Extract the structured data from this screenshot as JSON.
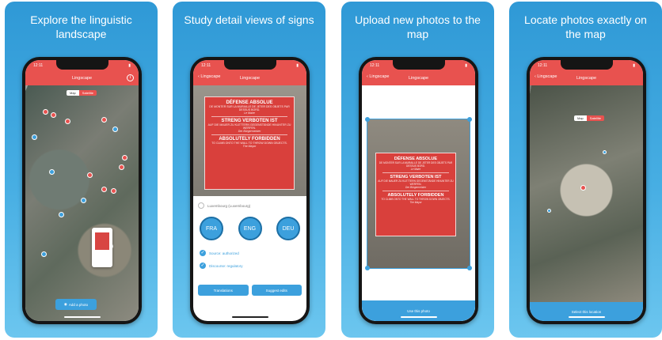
{
  "panels": [
    {
      "caption": "Explore the linguistic landscape",
      "status_time": "12:11",
      "nav_title": "Lingscape",
      "toggle": [
        "Map",
        "Satellite"
      ],
      "bottom_button": "Add a photo"
    },
    {
      "caption": "Study detail views of signs",
      "status_time": "12:11",
      "nav_back": "Lingscape",
      "nav_title": "Lingscape",
      "sign": {
        "fr_title": "DÉFENSE ABSOLUE",
        "fr_body": "DE MONTER SUR LA MURAILLE DE JETER DES OBJETS PAR DESSUS BORD.",
        "fr_sig": "Le Maire",
        "de_title": "STRENG VERBOTEN IST",
        "de_body": "AUF DIE MAUER ZU KLETTERN GEGENSTÄNDE HINUNTER ZU WERFEN.",
        "de_sig": "Der Bürgermeister",
        "en_title": "ABSOLUTELY FORBIDDEN",
        "en_body": "TO CLIMB ONTO THE WALL TO THROW DOWN OBJECTS.",
        "en_sig": "The Mayor"
      },
      "location": "Luxembourg (Luxembourg)",
      "languages": [
        "FRA",
        "ENG",
        "DEU"
      ],
      "checks": [
        "Source: authorized",
        "Discourse: regulatory"
      ],
      "buttons": [
        "Translations",
        "Suggest edits"
      ]
    },
    {
      "caption": "Upload new photos to the map",
      "status_time": "12:11",
      "nav_back": "Lingscape",
      "nav_title": "Lingscape",
      "bottom_bar": "Use this photo"
    },
    {
      "caption": "Locate photos exactly on the map",
      "status_time": "12:11",
      "nav_back": "Lingscape",
      "nav_title": "Lingscape",
      "toggle": [
        "Map",
        "Satellite"
      ],
      "bottom_bar": "Select this location"
    }
  ],
  "colors": {
    "accent_red": "#e8524f",
    "accent_blue": "#3ca0dd",
    "sign_red": "#d9403c"
  }
}
